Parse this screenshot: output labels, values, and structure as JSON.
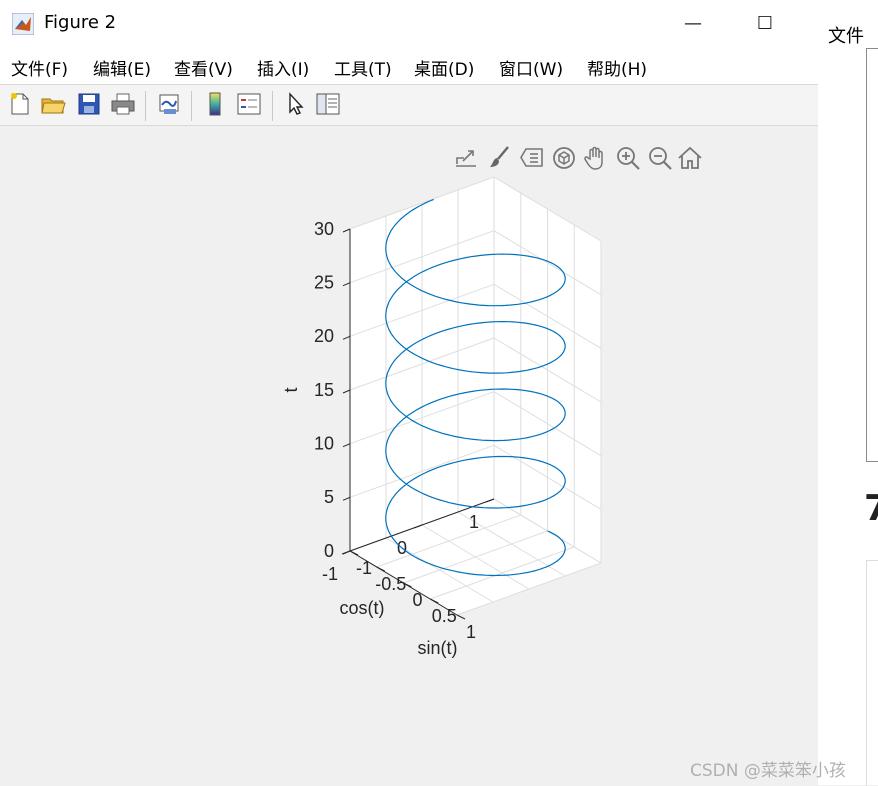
{
  "window": {
    "title": "Figure 2",
    "min_label": "—",
    "max_label": "☐"
  },
  "menu": [
    {
      "label": "文件(F)",
      "name": "menu-file"
    },
    {
      "label": "编辑(E)",
      "name": "menu-edit"
    },
    {
      "label": "查看(V)",
      "name": "menu-view"
    },
    {
      "label": "插入(I)",
      "name": "menu-insert"
    },
    {
      "label": "工具(T)",
      "name": "menu-tools"
    },
    {
      "label": "桌面(D)",
      "name": "menu-desktop"
    },
    {
      "label": "窗口(W)",
      "name": "menu-window"
    },
    {
      "label": "帮助(H)",
      "name": "menu-help"
    }
  ],
  "toolbar": [
    "new-figure-icon",
    "open-folder-icon",
    "save-icon",
    "print-icon",
    "link-plot-icon",
    "colorbar-icon",
    "legend-icon",
    "pointer-icon",
    "property-inspector-icon"
  ],
  "axes_toolbar": [
    "export-icon",
    "brush-icon",
    "data-tips-icon",
    "rotate-3d-icon",
    "pan-hand-icon",
    "zoom-in-icon",
    "zoom-out-icon",
    "home-icon"
  ],
  "chart_data": {
    "type": "line3d",
    "title": "",
    "xlabel": "sin(t)",
    "ylabel": "cos(t)",
    "zlabel": "t",
    "xlim": [
      -1,
      1
    ],
    "ylim": [
      -1,
      1
    ],
    "zlim": [
      0,
      30
    ],
    "xticks": [
      "-1",
      "-0.5",
      "0",
      "0.5",
      "1"
    ],
    "yticks": [
      "-1",
      "0",
      "1"
    ],
    "zticks": [
      "0",
      "5",
      "10",
      "15",
      "20",
      "25",
      "30"
    ],
    "series": [
      {
        "x": "sin(t)",
        "y": "cos(t)",
        "z": "t",
        "t_range": [
          0,
          30
        ],
        "color": "#0072bd"
      }
    ],
    "grid": true,
    "view": "3D default"
  },
  "right_panel": {
    "menu_label": "文件",
    "heading_digit": "7"
  },
  "watermark": "CSDN @菜菜笨小孩"
}
